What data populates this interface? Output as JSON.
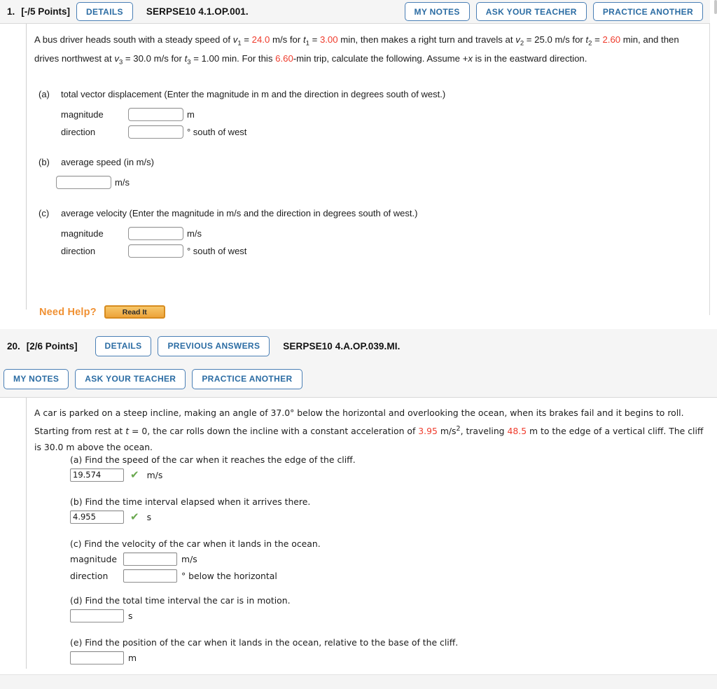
{
  "problem1": {
    "number": "1.",
    "points": "[-/5 Points]",
    "details_label": "DETAILS",
    "code": "SERPSE10 4.1.OP.001.",
    "my_notes_label": "MY NOTES",
    "ask_teacher_label": "ASK YOUR TEACHER",
    "practice_another_label": "PRACTICE ANOTHER",
    "statement": {
      "s1": "A bus driver heads south with a steady speed of ",
      "v1": "v",
      "v1sub": "1",
      "eq1": " = ",
      "val1": "24.0",
      "s2": " m/s for ",
      "t1": "t",
      "t1sub": "1",
      "eq2": " = ",
      "val2": "3.00",
      "s3": " min, then makes a right turn and travels at ",
      "v2": "v",
      "v2sub": "2",
      "eq3": " = ",
      "val3": "25.0",
      "s4": " m/s for ",
      "t2": "t",
      "t2sub": "2",
      "eq4": " = ",
      "val4": "2.60",
      "s5": " min, and then drives northwest at ",
      "v3": "v",
      "v3sub": "3",
      "eq5": " = ",
      "val5": "30.0",
      "s6": " m/s for ",
      "t3": "t",
      "t3sub": "3",
      "eq6": " = ",
      "val6": "1.00",
      "s7": " min. For this ",
      "val7": "6.60",
      "s8": "-min trip, calculate the following. Assume +",
      "x": "x",
      "s9": " is in the eastward direction."
    },
    "parts": [
      {
        "label": "(a)",
        "text": "total vector displacement (Enter the magnitude in m and the direction in degrees south of west.)",
        "fields": [
          {
            "label": "magnitude",
            "value": "",
            "unit": "m"
          },
          {
            "label": "direction",
            "value": "",
            "unit": "° south of west"
          }
        ]
      },
      {
        "label": "(b)",
        "text": "average speed (in m/s)",
        "fields": [
          {
            "label": "",
            "value": "",
            "unit": "m/s"
          }
        ]
      },
      {
        "label": "(c)",
        "text": "average velocity (Enter the magnitude in m/s and the direction in degrees south of west.)",
        "fields": [
          {
            "label": "magnitude",
            "value": "",
            "unit": "m/s"
          },
          {
            "label": "direction",
            "value": "",
            "unit": "° south of west"
          }
        ]
      }
    ],
    "need_help_label": "Need Help?",
    "read_it_label": "Read It"
  },
  "problem20": {
    "number": "20.",
    "points": "[2/6 Points]",
    "details_label": "DETAILS",
    "previous_answers_label": "PREVIOUS ANSWERS",
    "code": "SERPSE10 4.A.OP.039.MI.",
    "my_notes_label": "MY NOTES",
    "ask_teacher_label": "ASK YOUR TEACHER",
    "practice_another_label": "PRACTICE ANOTHER",
    "statement": {
      "s1": "A car is parked on a steep incline, making an angle of 37.0° below the horizontal and overlooking the ocean, when its brakes fail and it begins to roll. Starting from rest at ",
      "t": "t",
      "s2": " = 0, the car rolls down the incline with a constant acceleration of ",
      "accel": "3.95",
      "s3": " m/s",
      "exp": "2",
      "s4": ", traveling ",
      "dist": "48.5",
      "s5": " m to the edge of a vertical cliff. The cliff is 30.0 m above the ocean."
    },
    "parts": [
      {
        "label": "(a) Find the speed of the car when it reaches the edge of the cliff.",
        "value": "19.574",
        "correct": true,
        "unit": "m/s"
      },
      {
        "label": "(b) Find the time interval elapsed when it arrives there.",
        "value": "4.955",
        "correct": true,
        "unit": "s"
      },
      {
        "label": "(c) Find the velocity of the car when it lands in the ocean.",
        "magnitude_label": "magnitude",
        "magnitude_value": "",
        "magnitude_unit": "m/s",
        "direction_label": "direction",
        "direction_value": "",
        "direction_unit": "° below the horizontal"
      },
      {
        "label": "(d) Find the total time interval the car is in motion.",
        "value": "",
        "correct": false,
        "unit": "s"
      },
      {
        "label": "(e) Find the position of the car when it lands in the ocean, relative to the base of the cliff.",
        "value": "",
        "correct": false,
        "unit": "m"
      }
    ],
    "check_glyph": "✔"
  },
  "colors": {
    "accent_blue": "#2b6ca3",
    "highlight_red": "#ef3b2c",
    "need_help_orange": "#f09133",
    "correct_green": "#6aa84f"
  }
}
